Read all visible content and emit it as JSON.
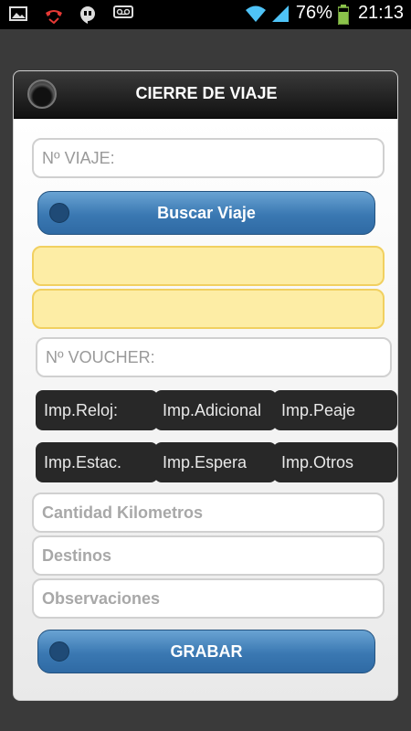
{
  "status_bar": {
    "icons_left": [
      "image-icon",
      "missed-call-icon",
      "hangouts-icon",
      "voicemail-icon"
    ],
    "battery_percent": "76%",
    "time": "21:13"
  },
  "dialog": {
    "title": "CIERRE DE VIAJE",
    "viaje_placeholder": "Nº VIAJE:",
    "buscar_label": "Buscar Viaje",
    "voucher_placeholder": "Nº VOUCHER:",
    "amount_buttons_row1": [
      "Imp.Reloj:",
      "Imp.Adicional",
      "Imp.Peaje"
    ],
    "amount_buttons_row2": [
      "Imp.Estac.",
      "Imp.Espera",
      "Imp.Otros"
    ],
    "kilometros_placeholder": "Cantidad Kilometros",
    "destinos_placeholder": "Destinos",
    "observaciones_placeholder": "Observaciones",
    "grabar_label": "GRABAR"
  },
  "colors": {
    "accent_blue": "#3a78b2",
    "yellow_field": "#fdeda5",
    "header_dark": "#1a1a1a"
  }
}
